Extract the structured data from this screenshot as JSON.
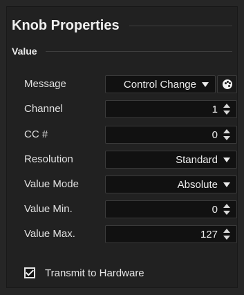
{
  "panel": {
    "title": "Knob Properties",
    "section": "Value"
  },
  "fields": {
    "message": {
      "label": "Message",
      "value": "Control Change"
    },
    "channel": {
      "label": "Channel",
      "value": "1"
    },
    "cc": {
      "label": "CC #",
      "value": "0"
    },
    "resolution": {
      "label": "Resolution",
      "value": "Standard"
    },
    "value_mode": {
      "label": "Value Mode",
      "value": "Absolute"
    },
    "value_min": {
      "label": "Value Min.",
      "value": "0"
    },
    "value_max": {
      "label": "Value Max.",
      "value": "127"
    }
  },
  "transmit": {
    "label": "Transmit to Hardware",
    "checked": true
  },
  "icons": {
    "learn": "palette-icon",
    "dropdown": "caret-down-icon",
    "spinner": "spinner-arrows-icon",
    "check": "checkmark-icon"
  }
}
